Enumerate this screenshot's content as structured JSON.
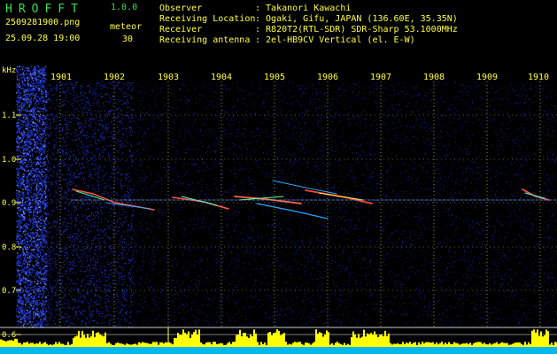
{
  "app": {
    "name": "HROFFT",
    "version": "1.0.0",
    "filename": "2509281900.png",
    "datetime": "25.09.28 19:00",
    "meteor_label": "meteor",
    "meteor_count": "30"
  },
  "info": [
    {
      "label": "Observer",
      "value": ": Takanori Kawachi"
    },
    {
      "label": "Receiving Location",
      "value": ": Ogaki, Gifu, JAPAN (136.60E, 35.35N)"
    },
    {
      "label": "Receiver",
      "value": ": R820T2(RTL-SDR) SDR-Sharp 53.1000MHz"
    },
    {
      "label": "Receiving antenna",
      "value": ": 2el-HB9CV Vertical (el. E-W)"
    }
  ],
  "axis": {
    "y_unit": "kHz",
    "x_ticks": [
      "1901",
      "1902",
      "1903",
      "1904",
      "1905",
      "1906",
      "1907",
      "1908",
      "1909",
      "1910"
    ],
    "y_ticks": [
      "1.1",
      "1.0",
      "0.9",
      "0.8",
      "0.7",
      "0.6"
    ]
  },
  "colors": {
    "background": "#000000",
    "noise": "#1a2fd0",
    "axis_text": "#ffff3a",
    "header_green": "#33e04a",
    "level_bars": "#ffff00",
    "baseline": "#00c8ff"
  }
}
